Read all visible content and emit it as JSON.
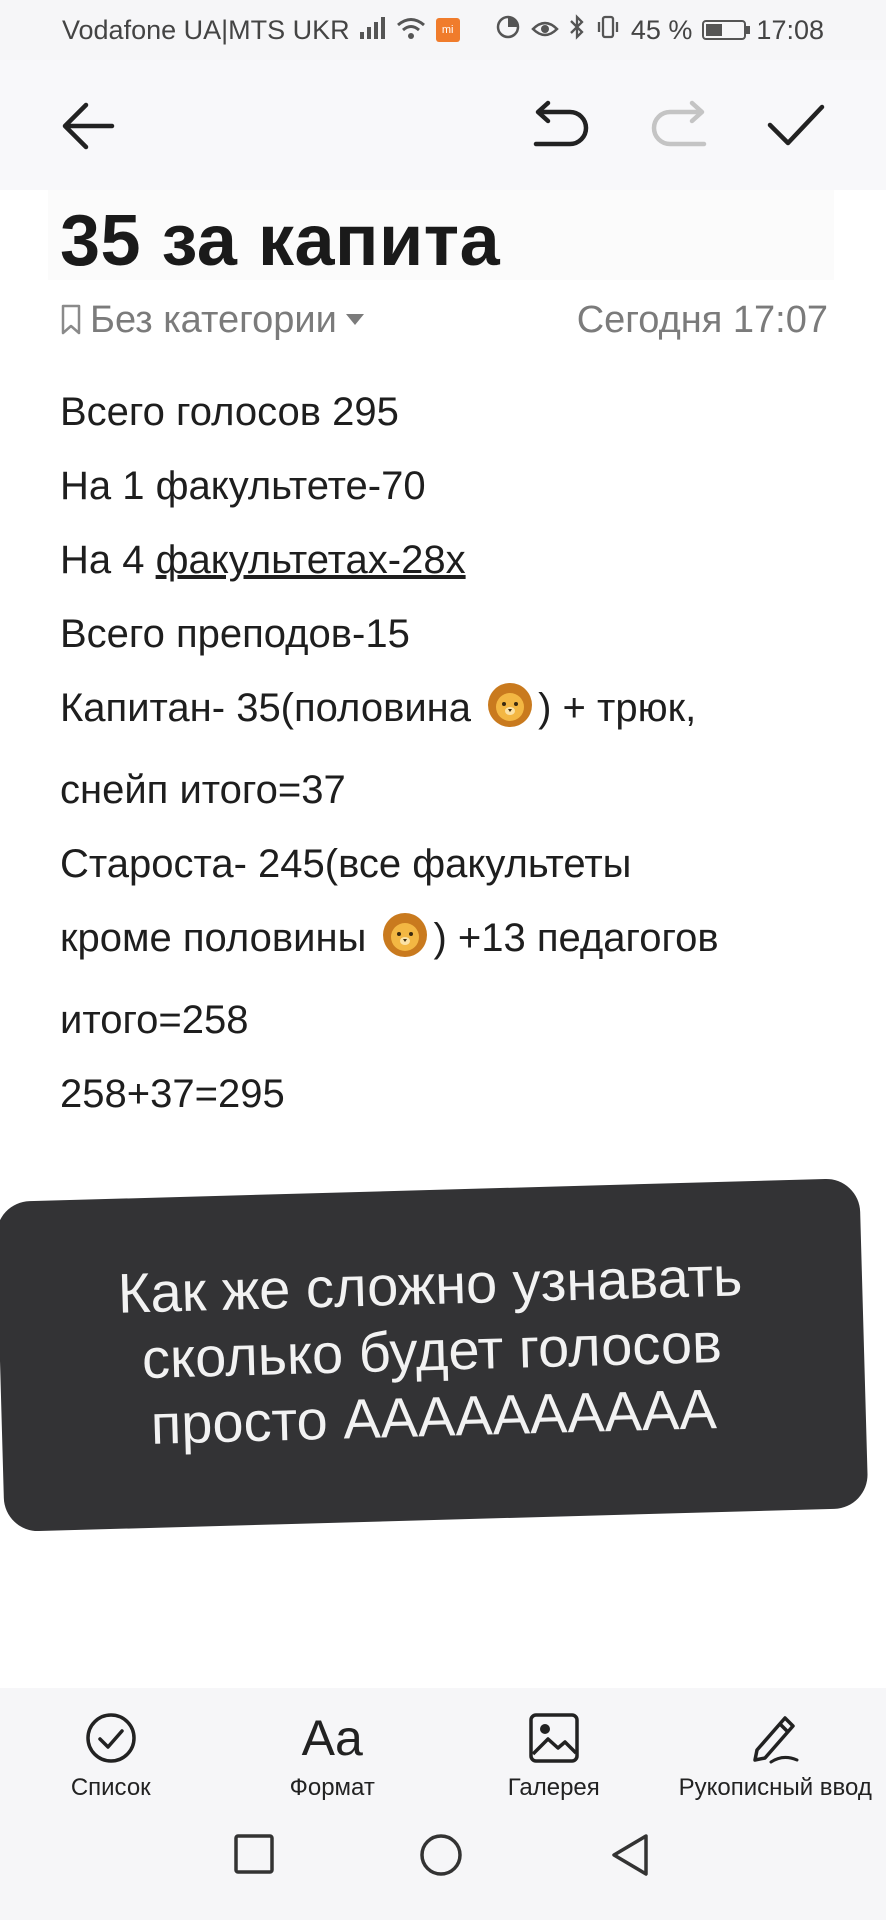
{
  "status_bar": {
    "carrier": "Vodafone UA|MTS UKR",
    "battery": "45 %",
    "battery_level": 0.45,
    "time": "17:08"
  },
  "toolbar": {
    "back_icon": "arrow-left-icon",
    "undo_icon": "undo-icon",
    "redo_icon": "redo-icon",
    "done_icon": "check-icon"
  },
  "note": {
    "title": "35 за капита",
    "category": "Без категории",
    "timestamp": "Сегодня 17:07",
    "lines": {
      "l1": "Всего голосов 295",
      "l2": "На 1 факультете-70",
      "l3_a": "На 4 ",
      "l3_b": "факультетах-28х",
      "l4": "Всего преподов-15",
      "l5_a": "Капитан- 35(половина ",
      "l5_b": ") + трюк,",
      "l6": "снейп итого=37",
      "l7": "Староста- 245(все факультеты",
      "l8_a": "кроме половины ",
      "l8_b": ") +13 педагогов",
      "l9": "итого=258",
      "l10": "258+37=295"
    },
    "emoji": "lion-face-icon"
  },
  "caption": {
    "line1": "Как же сложно узнавать",
    "line2": "сколько будет голосов",
    "line3": "просто АААААААААА"
  },
  "bottom_bar": {
    "list": "Список",
    "format": "Формат",
    "format_glyph": "Aa",
    "gallery": "Галерея",
    "handwriting": "Рукописный ввод"
  },
  "colors": {
    "caption_bg": "#333335",
    "meta_text": "#7b7b7b",
    "bars_bg": "#f6f6f8"
  }
}
